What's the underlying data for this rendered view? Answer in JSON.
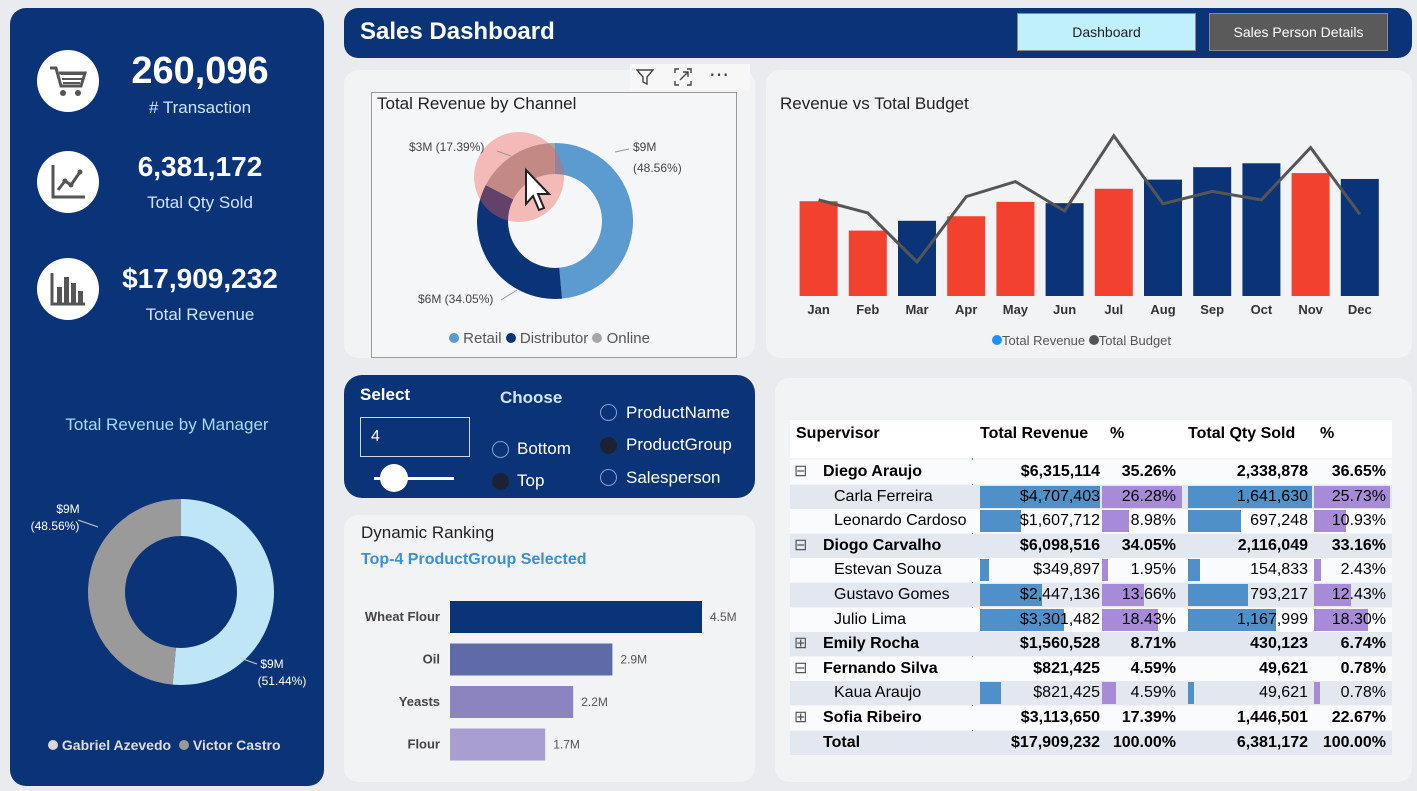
{
  "header": {
    "title": "Sales Dashboard",
    "nav": [
      "Dashboard",
      "Sales Person Details"
    ]
  },
  "kpis": [
    {
      "value": "260,096",
      "label": "# Transaction",
      "icon": "cart-icon"
    },
    {
      "value": "6,381,172",
      "label": "Total Qty Sold",
      "icon": "line-chart-icon"
    },
    {
      "value": "$17,909,232",
      "label": "Total Revenue",
      "icon": "bar-chart-icon"
    }
  ],
  "manager_chart": {
    "title": "Total Revenue by Manager",
    "labels": [
      "$9M\n(48.56%)",
      "$9M\n(51.44%)"
    ],
    "legend": [
      "Gabriel Azevedo",
      "Victor Castro"
    ],
    "colors": {
      "Gabriel Azevedo": "#bfe6f7",
      "Victor Castro": "#9a9a9a"
    }
  },
  "channel_chart": {
    "title": "Total Revenue by Channel",
    "labels": {
      "Retail": "$9M\n(48.56%)",
      "Distributor": "$6M (34.05%)",
      "Online": "$3M (17.39%)"
    },
    "legend": [
      "Retail",
      "Distributor",
      "Online"
    ],
    "colors": {
      "Retail": "#5b9bcf",
      "Distributor": "#0b3478",
      "Online": "#a6a6a6"
    }
  },
  "visual_toolbar": {
    "icons": [
      "filter-icon",
      "focus-mode-icon",
      "more-options-icon"
    ],
    "more": "⋯"
  },
  "chart_data": [
    {
      "type": "bar",
      "title": "Revenue vs Total Budget",
      "categories": [
        "Jan",
        "Feb",
        "Mar",
        "Apr",
        "May",
        "Jun",
        "Jul",
        "Aug",
        "Sep",
        "Oct",
        "Nov",
        "Dec"
      ],
      "series": [
        {
          "name": "Total Revenue",
          "type": "bar",
          "values": [
            1.45,
            1.0,
            1.15,
            1.22,
            1.44,
            1.42,
            1.64,
            1.78,
            1.97,
            2.03,
            1.88,
            1.79
          ],
          "colors": [
            "#f2412e",
            "#f2412e",
            "#0b3478",
            "#f2412e",
            "#f2412e",
            "#0b3478",
            "#f2412e",
            "#0b3478",
            "#0b3478",
            "#0b3478",
            "#f2412e",
            "#0b3478"
          ]
        },
        {
          "name": "Total Budget",
          "type": "line",
          "values": [
            1.47,
            1.27,
            0.52,
            1.52,
            1.75,
            1.3,
            2.45,
            1.41,
            1.6,
            1.47,
            2.27,
            1.25
          ]
        }
      ],
      "ylim": [
        0,
        2.6
      ],
      "legend_colors": {
        "Total Revenue": "#1e90ff",
        "Total Budget": "#555555"
      }
    },
    {
      "type": "bar",
      "title": "Dynamic Ranking",
      "subtitle": "Top-4 ProductGroup Selected",
      "categories": [
        "Wheat Flour",
        "Oil",
        "Yeasts",
        "Flour"
      ],
      "values": [
        4.5,
        2.9,
        2.2,
        1.7
      ],
      "labels": [
        "4.5M",
        "2.9M",
        "2.2M",
        "1.7M"
      ],
      "colors": [
        "#0b3478",
        "#5e6ba8",
        "#8b84bf",
        "#a89ed2"
      ],
      "xlim": [
        0,
        4.5
      ]
    },
    {
      "type": "pie",
      "title": "Total Revenue by Channel",
      "categories": [
        "Retail",
        "Distributor",
        "Online"
      ],
      "values": [
        48.56,
        34.05,
        17.39
      ]
    },
    {
      "type": "pie",
      "title": "Total Revenue by Manager",
      "categories": [
        "Gabriel Azevedo",
        "Victor Castro"
      ],
      "values": [
        51.44,
        48.56
      ]
    }
  ],
  "slicer": {
    "select_label": "Select",
    "select_value": "4",
    "slider_value": 0.25,
    "choose_label": "Choose",
    "choose_options": [
      "Bottom",
      "Top"
    ],
    "choose_selected": "Top",
    "dim_options": [
      "ProductName",
      "ProductGroup",
      "Salesperson"
    ],
    "dim_selected": "ProductGroup"
  },
  "matrix": {
    "headers": [
      "Supervisor",
      "Total Revenue",
      "%",
      "Total Qty Sold",
      "%"
    ],
    "rows": [
      {
        "level": 0,
        "toggle": "⊟",
        "name": "Diego Araujo",
        "rev": "$6,315,114",
        "rp": "35.26%",
        "qty": "2,338,878",
        "qp": "36.65%"
      },
      {
        "level": 1,
        "name": "Carla Ferreira",
        "rev": "$4,707,403",
        "rp": "26.28%",
        "qty": "1,641,630",
        "qp": "25.73%",
        "rv": 4707403,
        "rpv": 26.28,
        "qv": 1641630,
        "qpv": 25.73
      },
      {
        "level": 1,
        "name": "Leonardo Cardoso",
        "rev": "$1,607,712",
        "rp": "8.98%",
        "qty": "697,248",
        "qp": "10.93%",
        "rv": 1607712,
        "rpv": 8.98,
        "qv": 697248,
        "qpv": 10.93
      },
      {
        "level": 0,
        "toggle": "⊟",
        "name": "Diogo Carvalho",
        "rev": "$6,098,516",
        "rp": "34.05%",
        "qty": "2,116,049",
        "qp": "33.16%"
      },
      {
        "level": 1,
        "name": "Estevan Souza",
        "rev": "$349,897",
        "rp": "1.95%",
        "qty": "154,833",
        "qp": "2.43%",
        "rv": 349897,
        "rpv": 1.95,
        "qv": 154833,
        "qpv": 2.43
      },
      {
        "level": 1,
        "name": "Gustavo Gomes",
        "rev": "$2,447,136",
        "rp": "13.66%",
        "qty": "793,217",
        "qp": "12.43%",
        "rv": 2447136,
        "rpv": 13.66,
        "qv": 793217,
        "qpv": 12.43
      },
      {
        "level": 1,
        "name": "Julio Lima",
        "rev": "$3,301,482",
        "rp": "18.43%",
        "qty": "1,167,999",
        "qp": "18.30%",
        "rv": 3301482,
        "rpv": 18.43,
        "qv": 1167999,
        "qpv": 18.3
      },
      {
        "level": 0,
        "toggle": "⊞",
        "name": "Emily Rocha",
        "rev": "$1,560,528",
        "rp": "8.71%",
        "qty": "430,123",
        "qp": "6.74%"
      },
      {
        "level": 0,
        "toggle": "⊟",
        "name": "Fernando Silva",
        "rev": "$821,425",
        "rp": "4.59%",
        "qty": "49,621",
        "qp": "0.78%"
      },
      {
        "level": 1,
        "name": "Kaua Araujo",
        "rev": "$821,425",
        "rp": "4.59%",
        "qty": "49,621",
        "qp": "0.78%",
        "rv": 821425,
        "rpv": 4.59,
        "qv": 49621,
        "qpv": 0.78
      },
      {
        "level": 0,
        "toggle": "⊞",
        "name": "Sofia Ribeiro",
        "rev": "$3,113,650",
        "rp": "17.39%",
        "qty": "1,446,501",
        "qp": "22.67%"
      },
      {
        "level": 0,
        "name": "Total",
        "rev": "$17,909,232",
        "rp": "100.00%",
        "qty": "6,381,172",
        "qp": "100.00%"
      }
    ]
  }
}
